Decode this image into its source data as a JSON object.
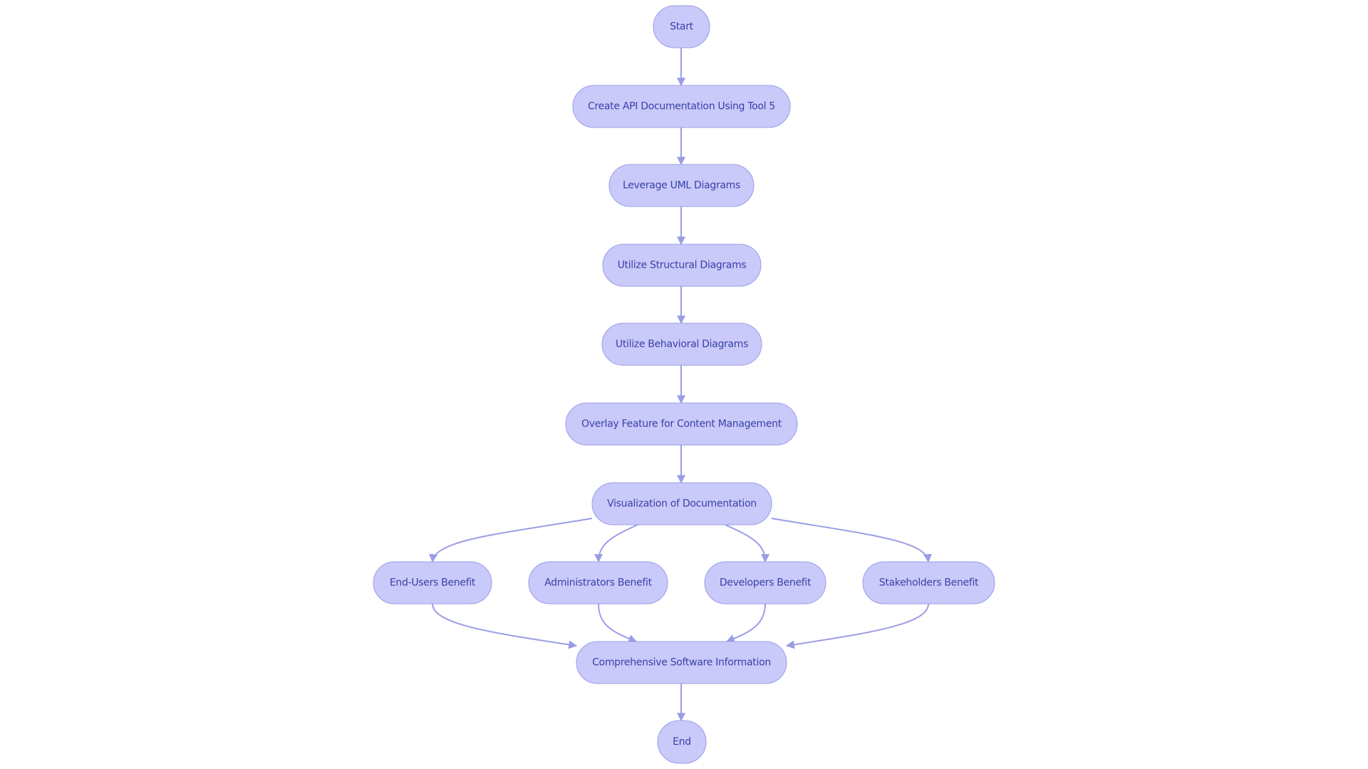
{
  "colors": {
    "node_fill": "#c9caf9",
    "node_stroke": "#9a9de6",
    "node_text": "#3a3ea6",
    "edge": "#9a9de6",
    "background": "#ffffff"
  },
  "nodes": [
    {
      "id": "start",
      "label": "Start"
    },
    {
      "id": "create_api",
      "label": "Create API Documentation Using Tool 5"
    },
    {
      "id": "leverage_uml",
      "label": "Leverage UML Diagrams"
    },
    {
      "id": "structural",
      "label": "Utilize Structural Diagrams"
    },
    {
      "id": "behavioral",
      "label": "Utilize Behavioral Diagrams"
    },
    {
      "id": "overlay",
      "label": "Overlay Feature for Content Management"
    },
    {
      "id": "visualization",
      "label": "Visualization of Documentation"
    },
    {
      "id": "end_users",
      "label": "End-Users Benefit"
    },
    {
      "id": "administrators",
      "label": "Administrators Benefit"
    },
    {
      "id": "developers",
      "label": "Developers Benefit"
    },
    {
      "id": "stakeholders",
      "label": "Stakeholders Benefit"
    },
    {
      "id": "comprehensive",
      "label": "Comprehensive Software Information"
    },
    {
      "id": "end",
      "label": "End"
    }
  ],
  "edges": [
    {
      "from": "start",
      "to": "create_api"
    },
    {
      "from": "create_api",
      "to": "leverage_uml"
    },
    {
      "from": "leverage_uml",
      "to": "structural"
    },
    {
      "from": "structural",
      "to": "behavioral"
    },
    {
      "from": "behavioral",
      "to": "overlay"
    },
    {
      "from": "overlay",
      "to": "visualization"
    },
    {
      "from": "visualization",
      "to": "end_users"
    },
    {
      "from": "visualization",
      "to": "administrators"
    },
    {
      "from": "visualization",
      "to": "developers"
    },
    {
      "from": "visualization",
      "to": "stakeholders"
    },
    {
      "from": "end_users",
      "to": "comprehensive"
    },
    {
      "from": "administrators",
      "to": "comprehensive"
    },
    {
      "from": "developers",
      "to": "comprehensive"
    },
    {
      "from": "stakeholders",
      "to": "comprehensive"
    },
    {
      "from": "comprehensive",
      "to": "end"
    }
  ]
}
